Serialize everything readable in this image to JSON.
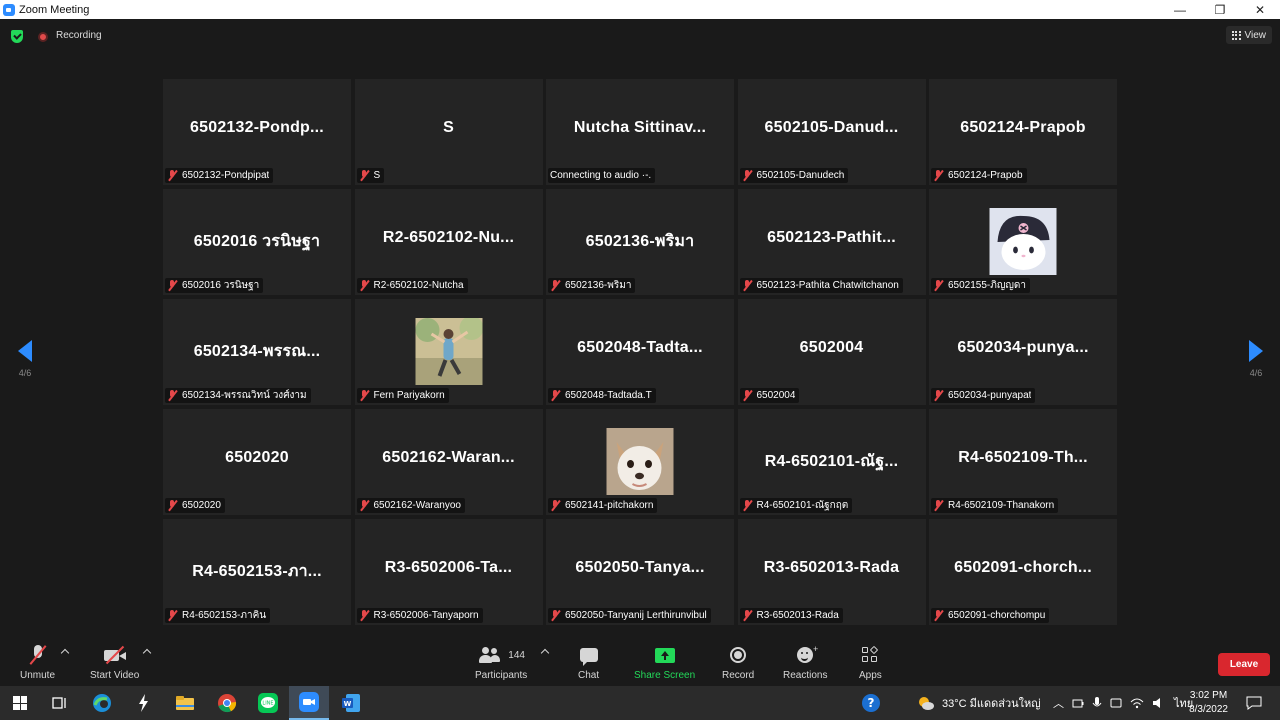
{
  "window": {
    "title": "Zoom Meeting",
    "minimize": "—",
    "maximize": "❐",
    "close": "✕"
  },
  "topbar": {
    "recording_label": "Recording",
    "view_label": "View"
  },
  "nav": {
    "prev_page": "4/6",
    "next_page": "4/6"
  },
  "tiles": [
    {
      "display": "6502132-Pondp...",
      "name": "6502132-Pondpipat",
      "muted": true
    },
    {
      "display": "S",
      "name": "S",
      "muted": true
    },
    {
      "display": "Nutcha  Sittinav...",
      "name": "Connecting to audio ·-.",
      "muted": false
    },
    {
      "display": "6502105-Danud...",
      "name": "6502105-Danudech",
      "muted": true
    },
    {
      "display": "6502124-Prapob",
      "name": "6502124-Prapob",
      "muted": true
    },
    {
      "display": "6502016 วรนิษฐา",
      "name": "6502016 วรนิษฐา",
      "muted": true
    },
    {
      "display": "R2-6502102-Nu...",
      "name": "R2-6502102-Nutcha",
      "muted": true
    },
    {
      "display": "6502136-พริมา",
      "name": "6502136-พริมา",
      "muted": true
    },
    {
      "display": "6502123-Pathit...",
      "name": "6502123-Pathita Chatwitchanon",
      "muted": true
    },
    {
      "display": "",
      "name": "6502155-ภิญญดา",
      "muted": true,
      "avatar": "kuromi"
    },
    {
      "display": "6502134-พรรณ...",
      "name": "6502134-พรรณวิทน์ วงศ์งาม",
      "muted": true
    },
    {
      "display": "",
      "name": "Fern Pariyakorn",
      "muted": true,
      "avatar": "photo-person"
    },
    {
      "display": "6502048-Tadta...",
      "name": "6502048-Tadtada.T",
      "muted": true
    },
    {
      "display": "6502004",
      "name": "6502004",
      "muted": true
    },
    {
      "display": "6502034-punya...",
      "name": "6502034-punyapat",
      "muted": true
    },
    {
      "display": "6502020",
      "name": "6502020",
      "muted": true
    },
    {
      "display": "6502162-Waran...",
      "name": "6502162-Waranyoo",
      "muted": true
    },
    {
      "display": "",
      "name": "6502141-pitchakorn",
      "muted": true,
      "avatar": "photo-dog"
    },
    {
      "display": "R4-6502101-ณัฐ...",
      "name": "R4-6502101-ณัฐกฤต",
      "muted": true
    },
    {
      "display": "R4-6502109-Th...",
      "name": "R4-6502109-Thanakorn",
      "muted": true
    },
    {
      "display": "R4-6502153-ภา...",
      "name": "R4-6502153-ภาคิน",
      "muted": true
    },
    {
      "display": "R3-6502006-Ta...",
      "name": "R3-6502006-Tanyaporn",
      "muted": true
    },
    {
      "display": "6502050-Tanya...",
      "name": "6502050-Tanyanij Lerthirunvibul",
      "muted": true
    },
    {
      "display": "R3-6502013-Rada",
      "name": "R3-6502013-Rada",
      "muted": true
    },
    {
      "display": "6502091-chorch...",
      "name": "6502091-chorchompu",
      "muted": true
    }
  ],
  "toolbar": {
    "unmute": "Unmute",
    "start_video": "Start Video",
    "participants": "Participants",
    "participants_count": "144",
    "chat": "Chat",
    "share_screen": "Share Screen",
    "record": "Record",
    "reactions": "Reactions",
    "apps": "Apps",
    "leave": "Leave"
  },
  "taskbar": {
    "weather": "33°C  มีแดดส่วนใหญ่",
    "language": "ไทย",
    "time": "3:02 PM",
    "date": "8/3/2022"
  },
  "colors": {
    "accent": "#2D8CFF",
    "share_green": "#23D959",
    "leave_red": "#D9272E",
    "muted_red": "#E4484A",
    "tile_bg": "#242424"
  }
}
